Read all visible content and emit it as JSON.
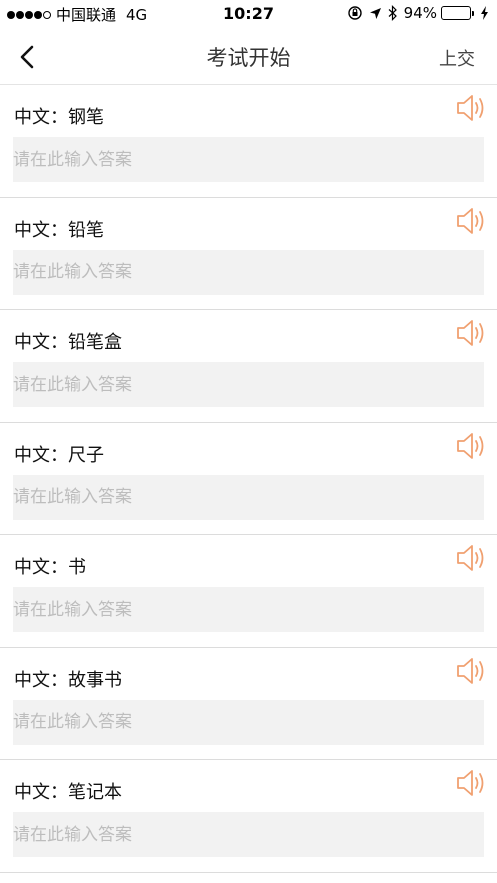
{
  "status_bar": {
    "carrier": "中国联通",
    "network": "4G",
    "time": "10:27",
    "battery_percent": "94%",
    "battery_level": 0.94,
    "battery_color": "#4cd964"
  },
  "nav": {
    "title": "考试开始",
    "submit_label": "上交",
    "back_icon": "chevron-left-icon"
  },
  "accent_color": "#f0a070",
  "questions": [
    {
      "label": "中文：钢笔",
      "answer": "",
      "placeholder": "请在此输入答案"
    },
    {
      "label": "中文：铅笔",
      "answer": "",
      "placeholder": "请在此输入答案"
    },
    {
      "label": "中文：铅笔盒",
      "answer": "",
      "placeholder": "请在此输入答案"
    },
    {
      "label": "中文：尺子",
      "answer": "",
      "placeholder": "请在此输入答案"
    },
    {
      "label": "中文：书",
      "answer": "",
      "placeholder": "请在此输入答案"
    },
    {
      "label": "中文：故事书",
      "answer": "",
      "placeholder": "请在此输入答案"
    },
    {
      "label": "中文：笔记本",
      "answer": "",
      "placeholder": "请在此输入答案"
    }
  ]
}
